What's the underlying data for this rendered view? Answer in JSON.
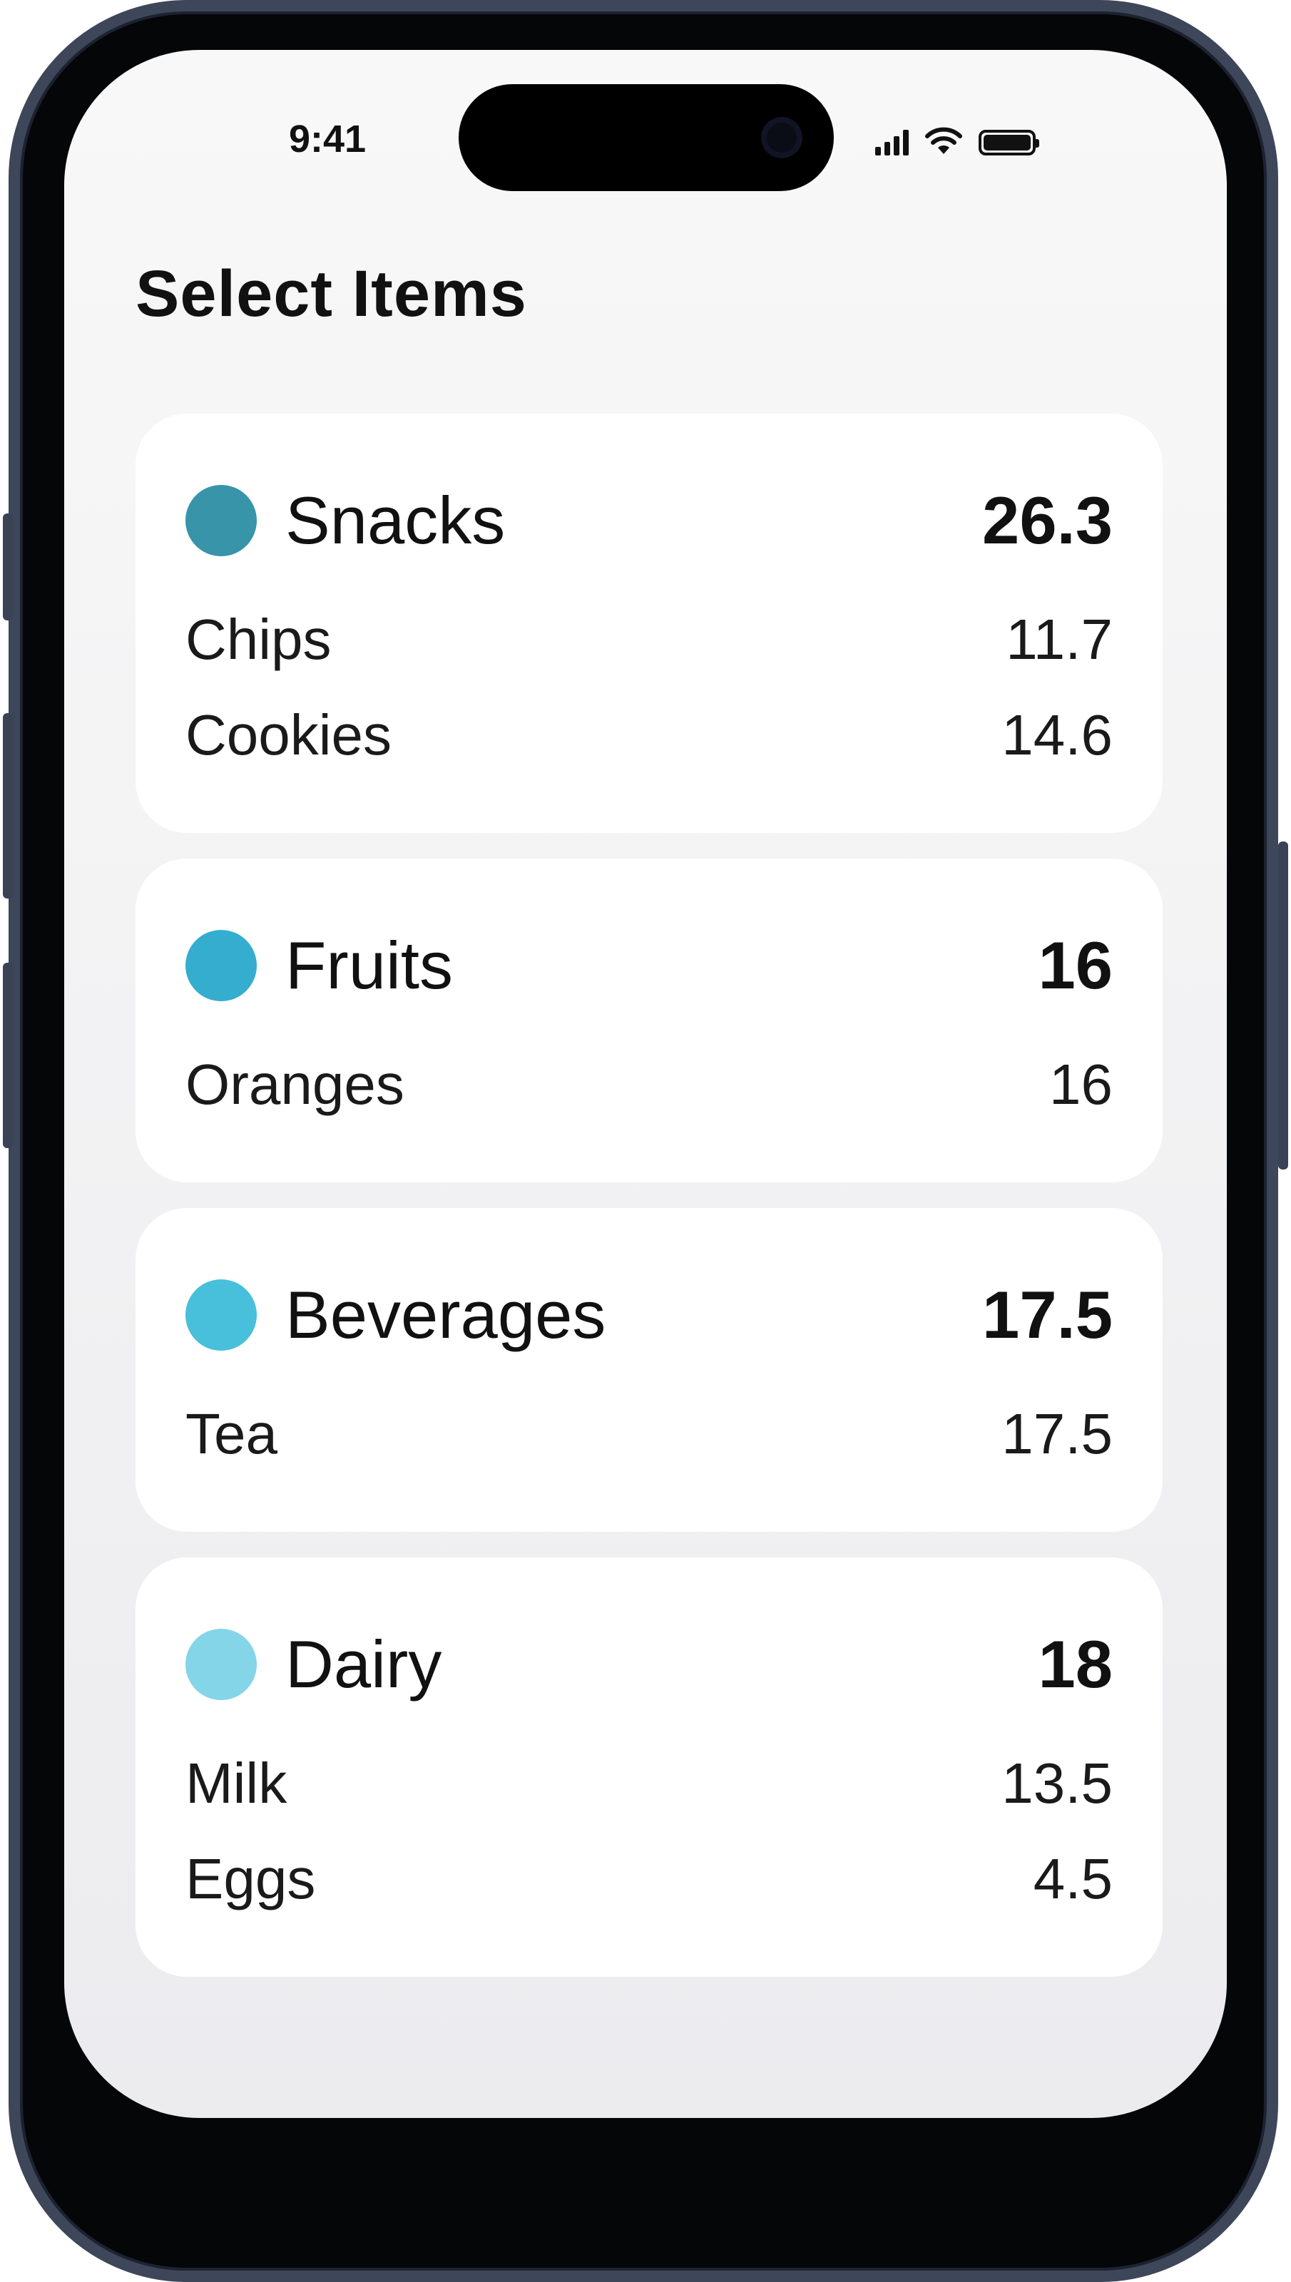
{
  "status_bar": {
    "time": "9:41",
    "signal_bars": 4,
    "battery_level": 1.0
  },
  "page": {
    "title": "Select Items"
  },
  "categories": [
    {
      "name": "Snacks",
      "total": "26.3",
      "color": "#3794a9",
      "items": [
        {
          "name": "Chips",
          "value": "11.7"
        },
        {
          "name": "Cookies",
          "value": "14.6"
        }
      ]
    },
    {
      "name": "Fruits",
      "total": "16",
      "color": "#35adcf",
      "items": [
        {
          "name": "Oranges",
          "value": "16"
        }
      ]
    },
    {
      "name": "Beverages",
      "total": "17.5",
      "color": "#48bfdb",
      "items": [
        {
          "name": "Tea",
          "value": "17.5"
        }
      ]
    },
    {
      "name": "Dairy",
      "total": "18",
      "color": "#84d5e8",
      "items": [
        {
          "name": "Milk",
          "value": "13.5"
        },
        {
          "name": "Eggs",
          "value": "4.5"
        }
      ]
    }
  ]
}
